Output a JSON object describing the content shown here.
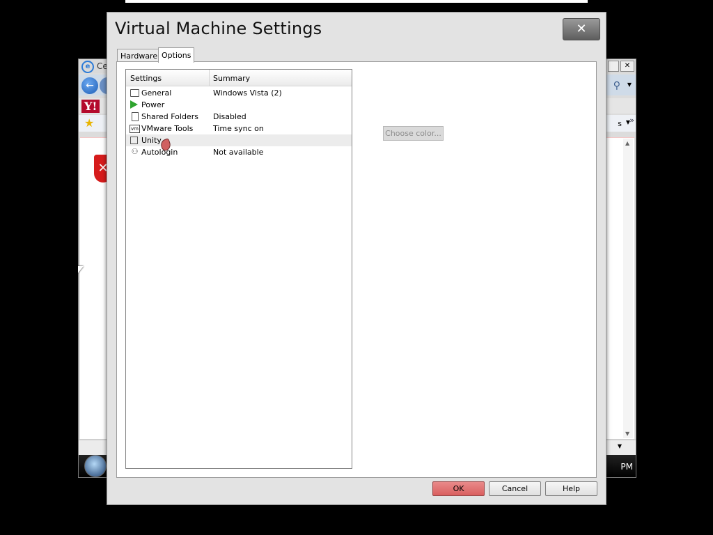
{
  "dialog": {
    "title": "Virtual Machine Settings",
    "close_glyph": "✕",
    "tabs": [
      {
        "label": "Hardware",
        "active": false
      },
      {
        "label": "Options",
        "active": true
      }
    ],
    "list": {
      "columns": {
        "settings": "Settings",
        "summary": "Summary"
      },
      "rows": [
        {
          "name": "General",
          "summary": "Windows Vista (2)",
          "icon": "monitor-icon"
        },
        {
          "name": "Power",
          "summary": "",
          "icon": "play-triangle-icon"
        },
        {
          "name": "Shared Folders",
          "summary": "Disabled",
          "icon": "folder-share-icon"
        },
        {
          "name": "VMware Tools",
          "summary": "Time sync on",
          "icon": "vm-icon"
        },
        {
          "name": "Unity",
          "summary": "",
          "icon": "unity-window-icon",
          "selected": true
        },
        {
          "name": "Autologin",
          "summary": "Not available",
          "icon": "users-icon"
        }
      ]
    },
    "choose_color_label": "Choose color...",
    "buttons": {
      "ok": "OK",
      "cancel": "Cancel",
      "help": "Help"
    }
  },
  "background_browser": {
    "title_fragment": "Ce",
    "yahoo_logo": "Y!",
    "tools_fragment": "s",
    "clock_fragment": "PM"
  },
  "colors": {
    "ok_button": "#d95f5f",
    "power_icon": "#2fa42f",
    "yahoo": "#b40a2c"
  }
}
